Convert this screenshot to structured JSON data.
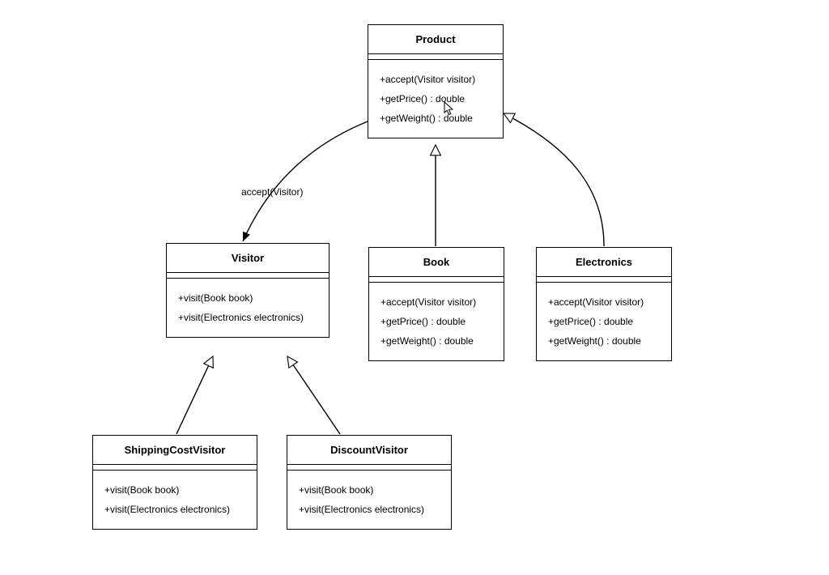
{
  "classes": {
    "product": {
      "name": "Product",
      "ops": [
        "+accept(Visitor visitor)",
        "+getPrice() : double",
        "+getWeight() : double"
      ]
    },
    "visitor": {
      "name": "Visitor",
      "ops": [
        "+visit(Book book)",
        "+visit(Electronics electronics)"
      ]
    },
    "book": {
      "name": "Book",
      "ops": [
        "+accept(Visitor visitor)",
        "+getPrice() : double",
        "+getWeight() : double"
      ]
    },
    "electronics": {
      "name": "Electronics",
      "ops": [
        "+accept(Visitor visitor)",
        "+getPrice() : double",
        "+getWeight() : double"
      ]
    },
    "shipping": {
      "name": "ShippingCostVisitor",
      "ops": [
        "+visit(Book book)",
        "+visit(Electronics electronics)"
      ]
    },
    "discount": {
      "name": "DiscountVisitor",
      "ops": [
        "+visit(Book book)",
        "+visit(Electronics electronics)"
      ]
    }
  },
  "edgeLabels": {
    "accept": "accept(Visitor)"
  }
}
